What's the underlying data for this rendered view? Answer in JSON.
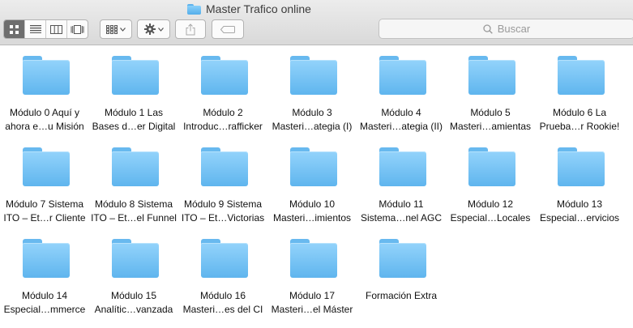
{
  "window": {
    "title": "Master Trafico online"
  },
  "toolbar": {
    "view_modes": [
      "icon-view-icon",
      "list-view-icon",
      "column-view-icon",
      "coverflow-view-icon"
    ],
    "active_view": 0,
    "search_placeholder": "Buscar"
  },
  "items": [
    {
      "line1": "Módulo  0 Aquí y",
      "line2": "ahora e…u Misión"
    },
    {
      "line1": "Módulo 1 Las",
      "line2": "Bases d…er Digital"
    },
    {
      "line1": "Módulo 2",
      "line2": "Introduc…rafficker"
    },
    {
      "line1": "Módulo 3",
      "line2": "Masteri…ategia (I)"
    },
    {
      "line1": "Módulo 4",
      "line2": "Masteri…ategia (II)"
    },
    {
      "line1": "Módulo 5",
      "line2": "Masteri…amientas"
    },
    {
      "line1": "Módulo 6 La",
      "line2": "Prueba…r Rookie!"
    },
    {
      "line1": "Módulo 7 Sistema",
      "line2": "ITO – Et…r Cliente"
    },
    {
      "line1": "Módulo 8 Sistema",
      "line2": "ITO – Et…el Funnel"
    },
    {
      "line1": "Módulo 9 Sistema",
      "line2": "ITO – Et…Victorias"
    },
    {
      "line1": "Módulo 10",
      "line2": "Masteri…imientos"
    },
    {
      "line1": "Módulo 11",
      "line2": "Sistema…nel AGC"
    },
    {
      "line1": "Módulo 12",
      "line2": "Especial…Locales"
    },
    {
      "line1": "Módulo 13",
      "line2": "Especial…ervicios"
    },
    {
      "line1": "Módulo 14",
      "line2": "Especial…mmerce"
    },
    {
      "line1": "Módulo 15",
      "line2": "Analític…vanzada"
    },
    {
      "line1": "Módulo 16",
      "line2": "Masteri…es del CI"
    },
    {
      "line1": "Módulo 17",
      "line2": "Masteri…el Máster"
    },
    {
      "line1": "Formación Extra",
      "line2": ""
    }
  ]
}
